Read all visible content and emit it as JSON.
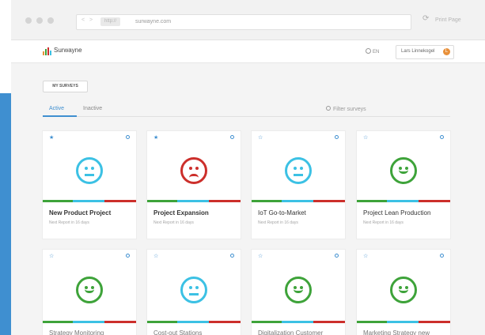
{
  "browser": {
    "chip_label": "http://",
    "url": "surwayne.com",
    "print_label": "Print Page"
  },
  "header": {
    "brand": "Surwayne",
    "language": "EN",
    "user_name": "Lars Linnekogel",
    "user_initial": "L"
  },
  "content": {
    "section_label": "MY SURVEYS",
    "tabs": [
      "Active",
      "Inactive"
    ],
    "filter_placeholder": "Filter surveys"
  },
  "colors": {
    "accent": "#3f8fd0",
    "green": "#3ea33a",
    "cyan": "#3cc1e4",
    "red": "#cc2f2b"
  },
  "cards": [
    {
      "title": "New Product Project",
      "subtitle": "Next Report in 16 days",
      "mood": "neutral",
      "starred": true
    },
    {
      "title": "Project Expansion",
      "subtitle": "Next Report in 16 days",
      "mood": "sad",
      "starred": true
    },
    {
      "title": "IoT Go-to-Market",
      "subtitle": "Next Report in 16 days",
      "mood": "neutral",
      "starred": false
    },
    {
      "title": "Project Lean Production",
      "subtitle": "Next Report in 16 days",
      "mood": "happy",
      "starred": false
    },
    {
      "title": "Strategy Monitoring",
      "subtitle": "",
      "mood": "happy",
      "starred": false
    },
    {
      "title": "Cost-out Stations",
      "subtitle": "",
      "mood": "neutral",
      "starred": false
    },
    {
      "title": "Digitalization Customer",
      "subtitle": "",
      "mood": "happy",
      "starred": false
    },
    {
      "title": "Marketing Strategy new",
      "subtitle": "",
      "mood": "happy",
      "starred": false
    }
  ]
}
